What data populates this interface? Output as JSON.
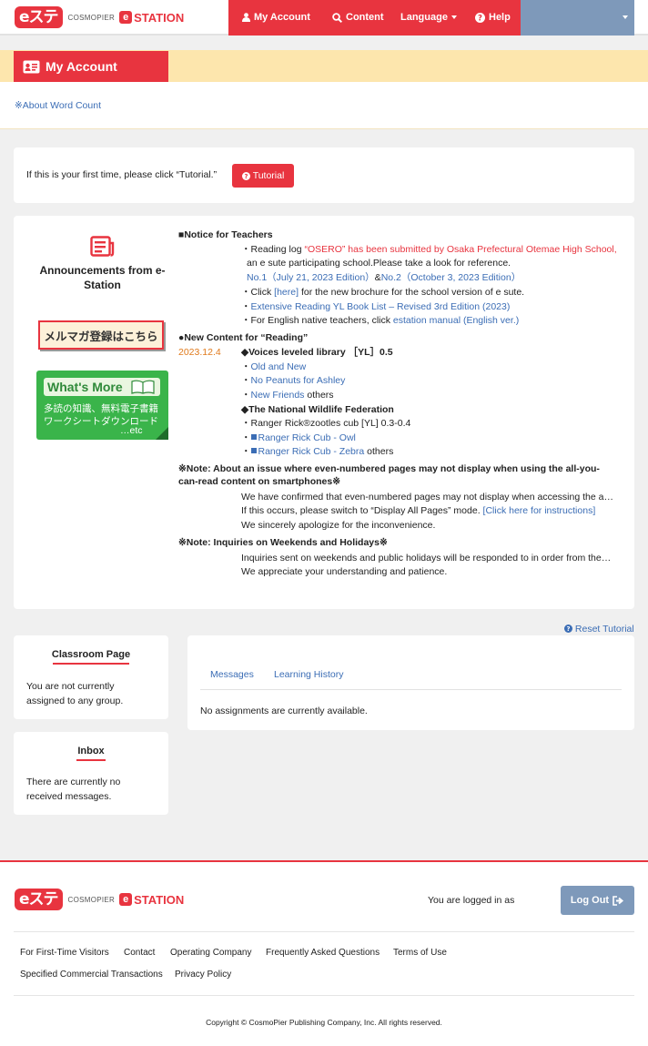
{
  "header": {
    "logo_mark": "eステ",
    "logo_publisher": "COSMOPIER",
    "logo_e": "e",
    "logo_station": "STATION",
    "nav": {
      "my_account": "My Account",
      "content": "Content",
      "language": "Language",
      "help": "Help"
    }
  },
  "page": {
    "title": "My Account",
    "about_word_count": "※About Word Count"
  },
  "tutorial": {
    "prompt": "If this is your first time, please click “Tutorial.”",
    "button": "Tutorial"
  },
  "announcements": {
    "title_line1": "Announcements from e-",
    "title_line2": "Station",
    "mailmag_banner": "メルマガ登録はこちら",
    "whats_more": {
      "title": "What's More",
      "line1": "多読の知識、無料電子書籍",
      "line2": "ワークシートダウンロード",
      "line3": "…etc"
    },
    "notice_heading": "■Notice for Teachers",
    "reading_log_prefix": "・Reading log ",
    "reading_log_red": "“OSERO” has been submitted by Osaka Prefectural Otemae High School,",
    "reading_log_cont": "an e sute participating school.Please take a look for reference.",
    "no1": "No.1（July 21, 2023 Edition）",
    "amp": "&",
    "no2": "No.2（October 3, 2023 Edition）",
    "brochure_prefix": "・Click ",
    "brochure_link": "[here]",
    "brochure_suffix": " for the new brochure for the school version of e sute.",
    "yl_dot": "・",
    "yl_link": "Extensive Reading YL Book List – Revised 3rd Edition (2023)",
    "manual_prefix": "・For English native teachers, click ",
    "manual_link": "estation manual (English ver.)",
    "new_content_heading": "●New Content for “Reading”",
    "date": "2023.12.4",
    "voices_heading": "◆Voices leveled library ［YL］0.5",
    "dot": "・",
    "voices_items": [
      "Old and New",
      "No Peanuts for Ashley",
      "New Friends"
    ],
    "others": " others",
    "nwf_heading": "◆The National Wildlife Federation",
    "ranger_line": "・Ranger Rick®zootles cub [YL] 0.3-0.4",
    "ranger_items": [
      "Ranger Rick Cub - Owl",
      "Ranger Rick Cub - Zebra"
    ],
    "note1_line1": "※Note: About an issue where even-numbered pages may not display when using the all-you-",
    "note1_line2": "can-read content on smartphones※",
    "note1_body1": "We have confirmed that even-numbered pages may not display when accessing the a…",
    "note1_body2_prefix": "If this occurs, please switch to “Display All Pages” mode. ",
    "note1_body2_link": "[Click here for instructions]",
    "note1_body3": "We sincerely apologize for the inconvenience.",
    "note2_heading": "※Note: Inquiries on Weekends and Holidays※",
    "note2_body1": "Inquiries sent on weekends and public holidays will be responded to in order from the…",
    "note2_body2": "We appreciate your understanding and patience."
  },
  "reset_tutorial": "Reset Tutorial",
  "classroom": {
    "title": "Classroom Page",
    "line1": "You are not currently",
    "line2": "assigned to any group."
  },
  "inbox": {
    "title": "Inbox",
    "line1": "There are currently no",
    "line2": "received messages."
  },
  "tabs": [
    "Messages",
    "Learning History"
  ],
  "assignments_empty": "No assignments are currently available.",
  "footer": {
    "logged_in": "You are logged in as",
    "logout": "Log Out",
    "links_row1": [
      "For First-Time Visitors",
      "Contact",
      "Operating Company",
      "Frequently Asked Questions",
      "Terms of Use"
    ],
    "links_row2": [
      "Specified Commercial Transactions",
      "Privacy Policy"
    ],
    "copyright": "Copyright © CosmoPier Publishing Company, Inc. All rights reserved."
  },
  "colors": {
    "brand_red": "#e8343f",
    "nav_gray_blue": "#7e99ba",
    "title_band": "#fde6ad",
    "link_blue": "#3b6db5",
    "date_orange": "#e07a1c",
    "whats_more_green": "#3ab44a"
  }
}
